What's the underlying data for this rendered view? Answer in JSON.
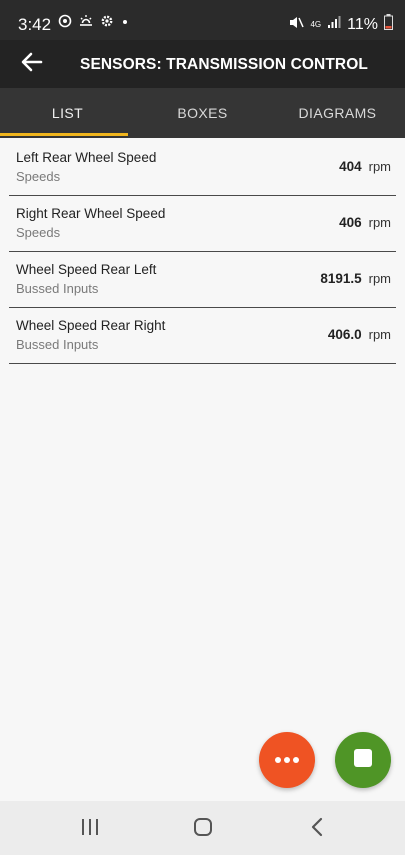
{
  "status_bar": {
    "time": "3:42",
    "network": "4G",
    "battery": "11%"
  },
  "app_bar": {
    "title": "SENSORS: TRANSMISSION CONTROL"
  },
  "tabs": [
    {
      "label": "LIST",
      "active": true
    },
    {
      "label": "BOXES",
      "active": false
    },
    {
      "label": "DIAGRAMS",
      "active": false
    }
  ],
  "sensors": [
    {
      "name": "Left Rear Wheel Speed",
      "category": "Speeds",
      "value": "404",
      "unit": "rpm"
    },
    {
      "name": "Right Rear Wheel Speed",
      "category": "Speeds",
      "value": "406",
      "unit": "rpm"
    },
    {
      "name": "Wheel Speed Rear Left",
      "category": "Bussed Inputs",
      "value": "8191.5",
      "unit": "rpm"
    },
    {
      "name": "Wheel Speed Rear Right",
      "category": "Bussed Inputs",
      "value": "406.0",
      "unit": "rpm"
    }
  ],
  "fabs": {
    "more_icon": "more-horizontal-icon",
    "stop_icon": "stop-square-icon"
  },
  "colors": {
    "tab_indicator": "#f0b51d",
    "fab_more": "#ef5323",
    "fab_stop": "#4f9526",
    "app_bar": "#232323",
    "tabs_bar": "#353535"
  }
}
